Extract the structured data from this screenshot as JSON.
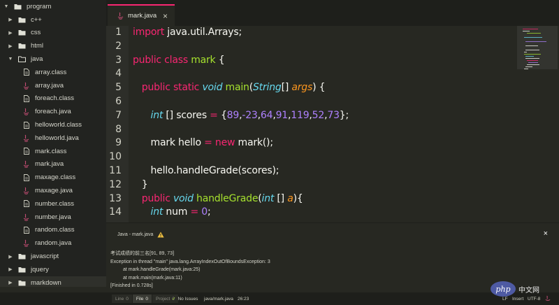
{
  "sidebar": {
    "items": [
      {
        "label": "program",
        "type": "folder",
        "depth": 0,
        "chevron": "down"
      },
      {
        "label": "c++",
        "type": "folder",
        "depth": 1,
        "chevron": "right"
      },
      {
        "label": "css",
        "type": "folder",
        "depth": 1,
        "chevron": "right"
      },
      {
        "label": "html",
        "type": "folder",
        "depth": 1,
        "chevron": "right"
      },
      {
        "label": "java",
        "type": "folder-open",
        "depth": 1,
        "chevron": "down"
      },
      {
        "label": "array.class",
        "type": "file",
        "depth": 2
      },
      {
        "label": "array.java",
        "type": "java",
        "depth": 2
      },
      {
        "label": "foreach.class",
        "type": "file",
        "depth": 2
      },
      {
        "label": "foreach.java",
        "type": "java",
        "depth": 2
      },
      {
        "label": "helloworld.class",
        "type": "file",
        "depth": 2
      },
      {
        "label": "helloworld.java",
        "type": "java",
        "depth": 2
      },
      {
        "label": "mark.class",
        "type": "file",
        "depth": 2
      },
      {
        "label": "mark.java",
        "type": "java",
        "depth": 2
      },
      {
        "label": "maxage.class",
        "type": "file",
        "depth": 2
      },
      {
        "label": "maxage.java",
        "type": "java",
        "depth": 2
      },
      {
        "label": "number.class",
        "type": "file",
        "depth": 2
      },
      {
        "label": "number.java",
        "type": "java",
        "depth": 2
      },
      {
        "label": "random.class",
        "type": "file",
        "depth": 2
      },
      {
        "label": "random.java",
        "type": "java",
        "depth": 2
      },
      {
        "label": "javascript",
        "type": "folder",
        "depth": 1,
        "chevron": "right"
      },
      {
        "label": "jquery",
        "type": "folder",
        "depth": 1,
        "chevron": "right"
      },
      {
        "label": "markdown",
        "type": "folder",
        "depth": 1,
        "chevron": "right",
        "selected": true
      }
    ]
  },
  "tab": {
    "label": "mark.java",
    "close": "×",
    "icon": "java-icon"
  },
  "editor": {
    "line_numbers": [
      "1",
      "2",
      "3",
      "4",
      "5",
      "6",
      "7",
      "8",
      "9",
      "10",
      "11",
      "12",
      "13",
      "14"
    ],
    "lines": [
      [
        {
          "t": "import ",
          "c": "kw"
        },
        {
          "t": "java.util.Arrays;",
          "c": ""
        }
      ],
      [],
      [
        {
          "t": "public class ",
          "c": "kw"
        },
        {
          "t": "mark",
          "c": "cls"
        },
        {
          "t": " {",
          "c": ""
        }
      ],
      [],
      [
        {
          "t": "   ",
          "c": ""
        },
        {
          "t": "public static ",
          "c": "kw"
        },
        {
          "t": "void ",
          "c": "typ"
        },
        {
          "t": "main",
          "c": "cls"
        },
        {
          "t": "(",
          "c": ""
        },
        {
          "t": "String",
          "c": "typ"
        },
        {
          "t": "[] ",
          "c": ""
        },
        {
          "t": "args",
          "c": "par"
        },
        {
          "t": ") {",
          "c": ""
        }
      ],
      [],
      [
        {
          "t": "      ",
          "c": ""
        },
        {
          "t": "int",
          "c": "typ"
        },
        {
          "t": " [] scores ",
          "c": ""
        },
        {
          "t": "=",
          "c": "kw"
        },
        {
          "t": " {",
          "c": ""
        },
        {
          "t": "89",
          "c": "num"
        },
        {
          "t": ",",
          "c": ""
        },
        {
          "t": "-23",
          "c": "num"
        },
        {
          "t": ",",
          "c": ""
        },
        {
          "t": "64",
          "c": "num"
        },
        {
          "t": ",",
          "c": ""
        },
        {
          "t": "91",
          "c": "num"
        },
        {
          "t": ",",
          "c": ""
        },
        {
          "t": "119",
          "c": "num"
        },
        {
          "t": ",",
          "c": ""
        },
        {
          "t": "52",
          "c": "num"
        },
        {
          "t": ",",
          "c": ""
        },
        {
          "t": "73",
          "c": "num"
        },
        {
          "t": "};",
          "c": ""
        }
      ],
      [],
      [
        {
          "t": "      mark hello ",
          "c": ""
        },
        {
          "t": "=",
          "c": "kw"
        },
        {
          "t": " ",
          "c": ""
        },
        {
          "t": "new",
          "c": "kw"
        },
        {
          "t": " mark();",
          "c": ""
        }
      ],
      [],
      [
        {
          "t": "      hello.handleGrade(scores);",
          "c": ""
        }
      ],
      [
        {
          "t": "   }",
          "c": ""
        }
      ],
      [
        {
          "t": "   ",
          "c": ""
        },
        {
          "t": "public ",
          "c": "kw"
        },
        {
          "t": "void ",
          "c": "typ"
        },
        {
          "t": "handleGrade",
          "c": "cls"
        },
        {
          "t": "(",
          "c": ""
        },
        {
          "t": "int",
          "c": "typ"
        },
        {
          "t": " [] ",
          "c": ""
        },
        {
          "t": "a",
          "c": "par"
        },
        {
          "t": "){",
          "c": ""
        }
      ],
      [
        {
          "t": "      ",
          "c": ""
        },
        {
          "t": "int",
          "c": "typ"
        },
        {
          "t": " num ",
          "c": ""
        },
        {
          "t": "=",
          "c": "kw"
        },
        {
          "t": " ",
          "c": ""
        },
        {
          "t": "0",
          "c": "num"
        },
        {
          "t": ";",
          "c": ""
        }
      ]
    ]
  },
  "panel": {
    "title": "Java - mark.java",
    "close": "×",
    "output": [
      {
        "text": "考试成绩的前三名[91, 89, 73]",
        "indent": false
      },
      {
        "text": "Exception in thread \"main\" java.lang.ArrayIndexOutOfBoundsException: 3",
        "indent": false
      },
      {
        "text": "at mark.handleGrade(mark.java:25)",
        "indent": true
      },
      {
        "text": "at mark.main(mark.java:11)",
        "indent": true
      },
      {
        "text": "[Finished in 0.728s]",
        "indent": false
      }
    ]
  },
  "status": {
    "scopes": [
      {
        "label": "Line",
        "count": "0",
        "active": false
      },
      {
        "label": "File",
        "count": "0",
        "active": true
      },
      {
        "label": "Project",
        "count": "0",
        "active": false
      }
    ],
    "issues": "No Issues",
    "path": "java/mark.java",
    "cursor": "26:23",
    "line_ending": "LF",
    "mode": "Insert",
    "encoding": "UTF-8",
    "watermark_text": "中文网",
    "watermark_logo": "php"
  },
  "colors": {
    "keyword": "#f92672",
    "class": "#a6e22e",
    "type": "#66d9ef",
    "param": "#fd971f",
    "number": "#ae81ff",
    "background": "#272822"
  }
}
